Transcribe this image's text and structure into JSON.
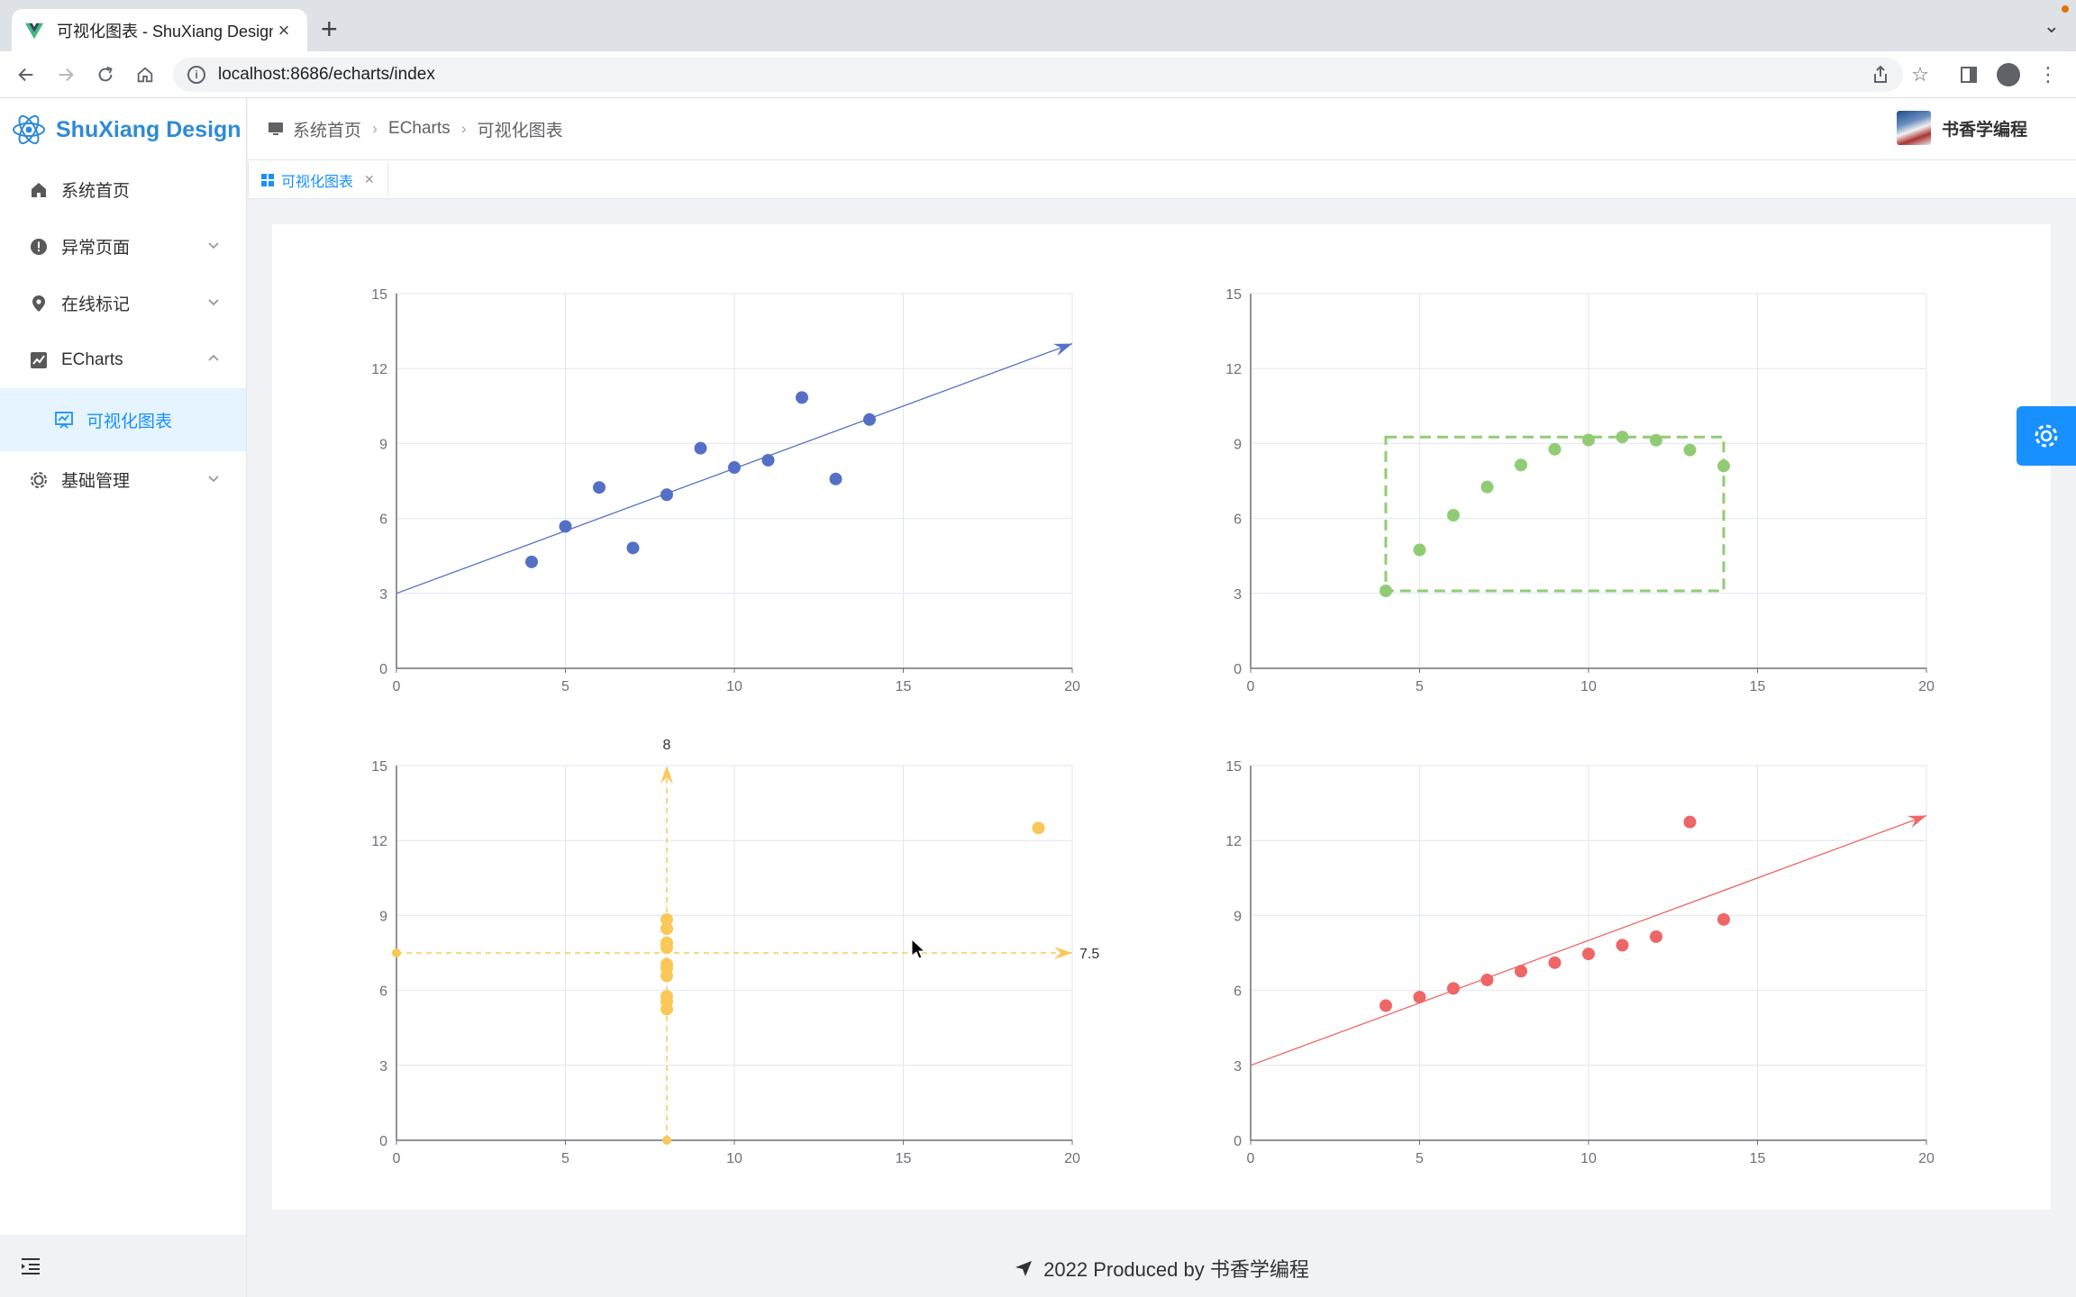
{
  "browser": {
    "tab_title": "可视化图表 - ShuXiang Design",
    "url": "localhost:8686/echarts/index"
  },
  "sidebar": {
    "logo_text": "ShuXiang Design",
    "items": [
      {
        "label": "系统首页",
        "icon": "home-icon"
      },
      {
        "label": "异常页面",
        "icon": "exclamation-icon"
      },
      {
        "label": "在线标记",
        "icon": "location-pin-icon"
      },
      {
        "label": "ECharts",
        "icon": "chart-icon"
      },
      {
        "label": "可视化图表",
        "icon": "presentation-icon"
      },
      {
        "label": "基础管理",
        "icon": "gear-icon"
      }
    ]
  },
  "header": {
    "breadcrumb": [
      "系统首页",
      "ECharts",
      "可视化图表"
    ],
    "user_name": "书香学编程"
  },
  "tags": [
    {
      "label": "可视化图表",
      "active": true
    }
  ],
  "footer": {
    "text": "2022 Produced by 书香学编程"
  },
  "colors": {
    "accent": "#1890ff",
    "series1": "#5470c6",
    "series2": "#91cc75",
    "series3": "#fac858",
    "series4": "#ee6666"
  },
  "chart_data": [
    {
      "type": "scatter",
      "title": "",
      "xlim": [
        0,
        20
      ],
      "ylim": [
        0,
        15
      ],
      "xticks": [
        0,
        5,
        10,
        15,
        20
      ],
      "yticks": [
        0,
        3,
        6,
        9,
        12,
        15
      ],
      "color": "#5470c6",
      "points": [
        [
          10,
          8.04
        ],
        [
          8,
          6.95
        ],
        [
          13,
          7.58
        ],
        [
          9,
          8.81
        ],
        [
          11,
          8.33
        ],
        [
          14,
          9.96
        ],
        [
          6,
          7.24
        ],
        [
          4,
          4.26
        ],
        [
          12,
          10.84
        ],
        [
          7,
          4.82
        ],
        [
          5,
          5.68
        ]
      ],
      "markline": {
        "from": [
          0,
          3
        ],
        "to": [
          20,
          13
        ],
        "arrow": true
      }
    },
    {
      "type": "scatter",
      "title": "",
      "xlim": [
        0,
        20
      ],
      "ylim": [
        0,
        15
      ],
      "xticks": [
        0,
        5,
        10,
        15,
        20
      ],
      "yticks": [
        0,
        3,
        6,
        9,
        12,
        15
      ],
      "color": "#91cc75",
      "points": [
        [
          10,
          9.14
        ],
        [
          8,
          8.14
        ],
        [
          13,
          8.74
        ],
        [
          9,
          8.77
        ],
        [
          11,
          9.26
        ],
        [
          14,
          8.1
        ],
        [
          6,
          6.13
        ],
        [
          4,
          3.1
        ],
        [
          12,
          9.13
        ],
        [
          7,
          7.26
        ],
        [
          5,
          4.74
        ]
      ],
      "markarea": {
        "from": [
          4,
          3.1
        ],
        "to": [
          14,
          9.26
        ]
      }
    },
    {
      "type": "scatter",
      "title": "",
      "xlim": [
        0,
        20
      ],
      "ylim": [
        0,
        15
      ],
      "xticks": [
        0,
        5,
        10,
        15,
        20
      ],
      "yticks": [
        0,
        3,
        6,
        9,
        12,
        15
      ],
      "color": "#fac858",
      "points": [
        [
          8,
          6.58
        ],
        [
          8,
          5.76
        ],
        [
          8,
          7.71
        ],
        [
          8,
          8.84
        ],
        [
          8,
          8.47
        ],
        [
          8,
          7.04
        ],
        [
          8,
          5.25
        ],
        [
          19,
          12.5
        ],
        [
          8,
          5.56
        ],
        [
          8,
          7.91
        ],
        [
          8,
          6.89
        ]
      ],
      "marklines": [
        {
          "axis": "x",
          "value": 8,
          "label": "8"
        },
        {
          "axis": "y",
          "value": 7.5,
          "label": "7.5"
        }
      ]
    },
    {
      "type": "scatter",
      "title": "",
      "xlim": [
        0,
        20
      ],
      "ylim": [
        0,
        15
      ],
      "xticks": [
        0,
        5,
        10,
        15,
        20
      ],
      "yticks": [
        0,
        3,
        6,
        9,
        12,
        15
      ],
      "color": "#ee6666",
      "points": [
        [
          10,
          7.46
        ],
        [
          8,
          6.77
        ],
        [
          13,
          12.74
        ],
        [
          9,
          7.11
        ],
        [
          11,
          7.81
        ],
        [
          14,
          8.84
        ],
        [
          6,
          6.08
        ],
        [
          4,
          5.39
        ],
        [
          12,
          8.15
        ],
        [
          7,
          6.42
        ],
        [
          5,
          5.73
        ]
      ],
      "markline": {
        "from": [
          0,
          3
        ],
        "to": [
          20,
          13
        ],
        "arrow": true
      }
    }
  ]
}
